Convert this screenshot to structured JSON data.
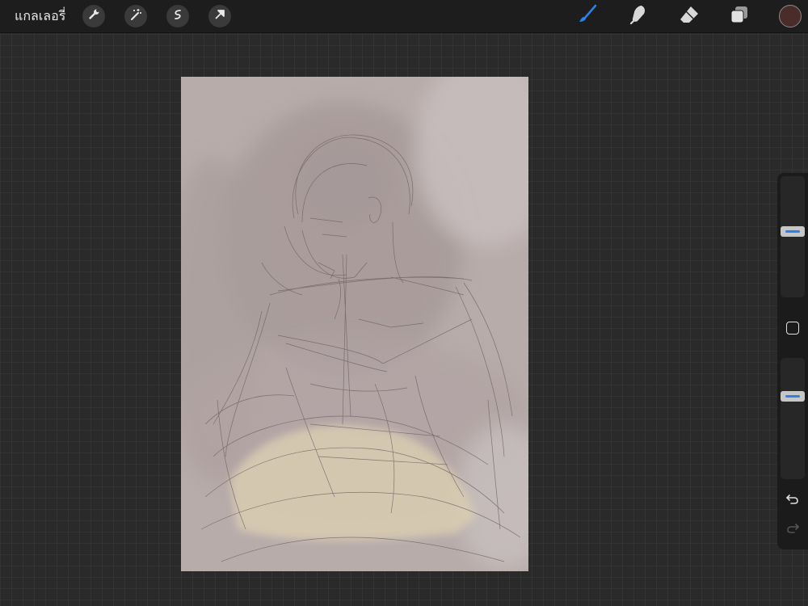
{
  "topbar": {
    "gallery_label": "แกลเลอรี่",
    "actions_icon": "wrench-icon",
    "adjustments_icon": "magic-wand-icon",
    "selection_icon": "selection-s-icon",
    "transform_icon": "arrow-cursor-icon"
  },
  "tools": {
    "brush_icon": "brush-icon",
    "smudge_icon": "smudge-finger-icon",
    "eraser_icon": "eraser-icon",
    "layers_icon": "layers-icon",
    "active_tool": "brush"
  },
  "colors": {
    "current_color": "#4a2c2a",
    "accent": "#2a82ea",
    "canvas_bg": "#b8acab",
    "cream_fill": "#d9cdb1"
  },
  "sidebar": {
    "brush_size_level": 0.55,
    "opacity_level": 0.7,
    "modify_icon": "square-modify-icon",
    "undo_icon": "undo-icon",
    "redo_icon": "redo-icon",
    "redo_enabled": false
  }
}
